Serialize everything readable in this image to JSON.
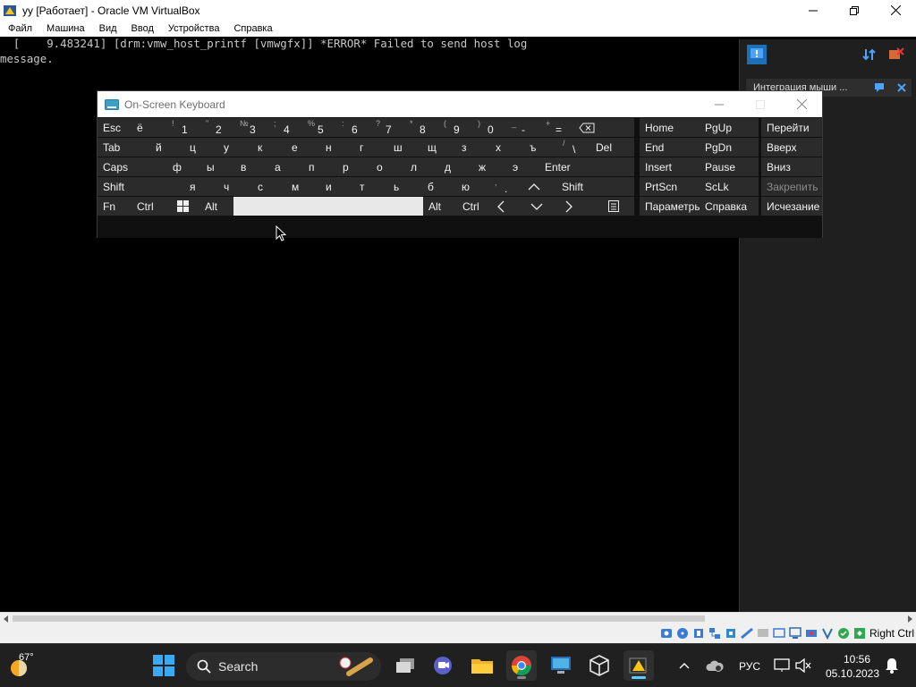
{
  "window": {
    "title": "yy [Работает] - Oracle VM VirtualBox",
    "menu": [
      "Файл",
      "Машина",
      "Вид",
      "Ввод",
      "Устройства",
      "Справка"
    ]
  },
  "console": {
    "lines": [
      "  [    9.483241] [drm:vmw_host_printf [vmwgfx]] *ERROR* Failed to send host log",
      "message."
    ]
  },
  "guest_panel": {
    "notice": "Интеграция мыши ..."
  },
  "osk": {
    "title": "On-Screen Keyboard",
    "row1": [
      {
        "label": "Esc"
      },
      {
        "label": "ё"
      },
      {
        "top": "!",
        "main": "1"
      },
      {
        "top": "\"",
        "main": "2"
      },
      {
        "top": "№",
        "main": "3"
      },
      {
        "top": ";",
        "main": "4"
      },
      {
        "top": "%",
        "main": "5"
      },
      {
        "top": ":",
        "main": "6"
      },
      {
        "top": "?",
        "main": "7"
      },
      {
        "top": "*",
        "main": "8"
      },
      {
        "top": "(",
        "main": "9"
      },
      {
        "top": ")",
        "main": "0"
      },
      {
        "top": "_",
        "main": "-"
      },
      {
        "top": "+",
        "main": "="
      }
    ],
    "row2": [
      "Tab",
      "й",
      "ц",
      "у",
      "к",
      "е",
      "н",
      "г",
      "ш",
      "щ",
      "з",
      "х",
      "ъ"
    ],
    "row2_slash": {
      "top": "/",
      "main": "\\"
    },
    "row2_del": "Del",
    "row3": [
      "Caps",
      "ф",
      "ы",
      "в",
      "а",
      "п",
      "р",
      "о",
      "л",
      "д",
      "ж",
      "э",
      "Enter"
    ],
    "row4": [
      "Shift",
      "я",
      "ч",
      "с",
      "м",
      "и",
      "т",
      "ь",
      "б",
      "ю"
    ],
    "row4_period": {
      "top": ",",
      "main": "."
    },
    "row4_shift_r": "Shift",
    "row5": {
      "fn": "Fn",
      "ctrl": "Ctrl",
      "alt": "Alt",
      "alt_r": "Alt",
      "ctrl_r": "Ctrl"
    },
    "nav": {
      "home": "Home",
      "pgup": "PgUp",
      "goto": "Перейти",
      "end": "End",
      "pgdn": "PgDn",
      "up": "Вверх",
      "insert": "Insert",
      "pause": "Pause",
      "down": "Вниз",
      "prtscn": "PrtScn",
      "sclk": "ScLk",
      "pin": "Закрепить",
      "options": "Параметры",
      "help": "Справка",
      "fade": "Исчезание"
    }
  },
  "statusbar": {
    "host_key": "Right Ctrl"
  },
  "taskbar": {
    "weather_temp": "67°",
    "search_label": "Search",
    "lang": "РУС",
    "time": "10:56",
    "date": "05.10.2023"
  },
  "colors": {
    "osk_key": "#2b2b2b",
    "taskbar": "#202020",
    "vbox_chrome": "#f0f0f0"
  }
}
